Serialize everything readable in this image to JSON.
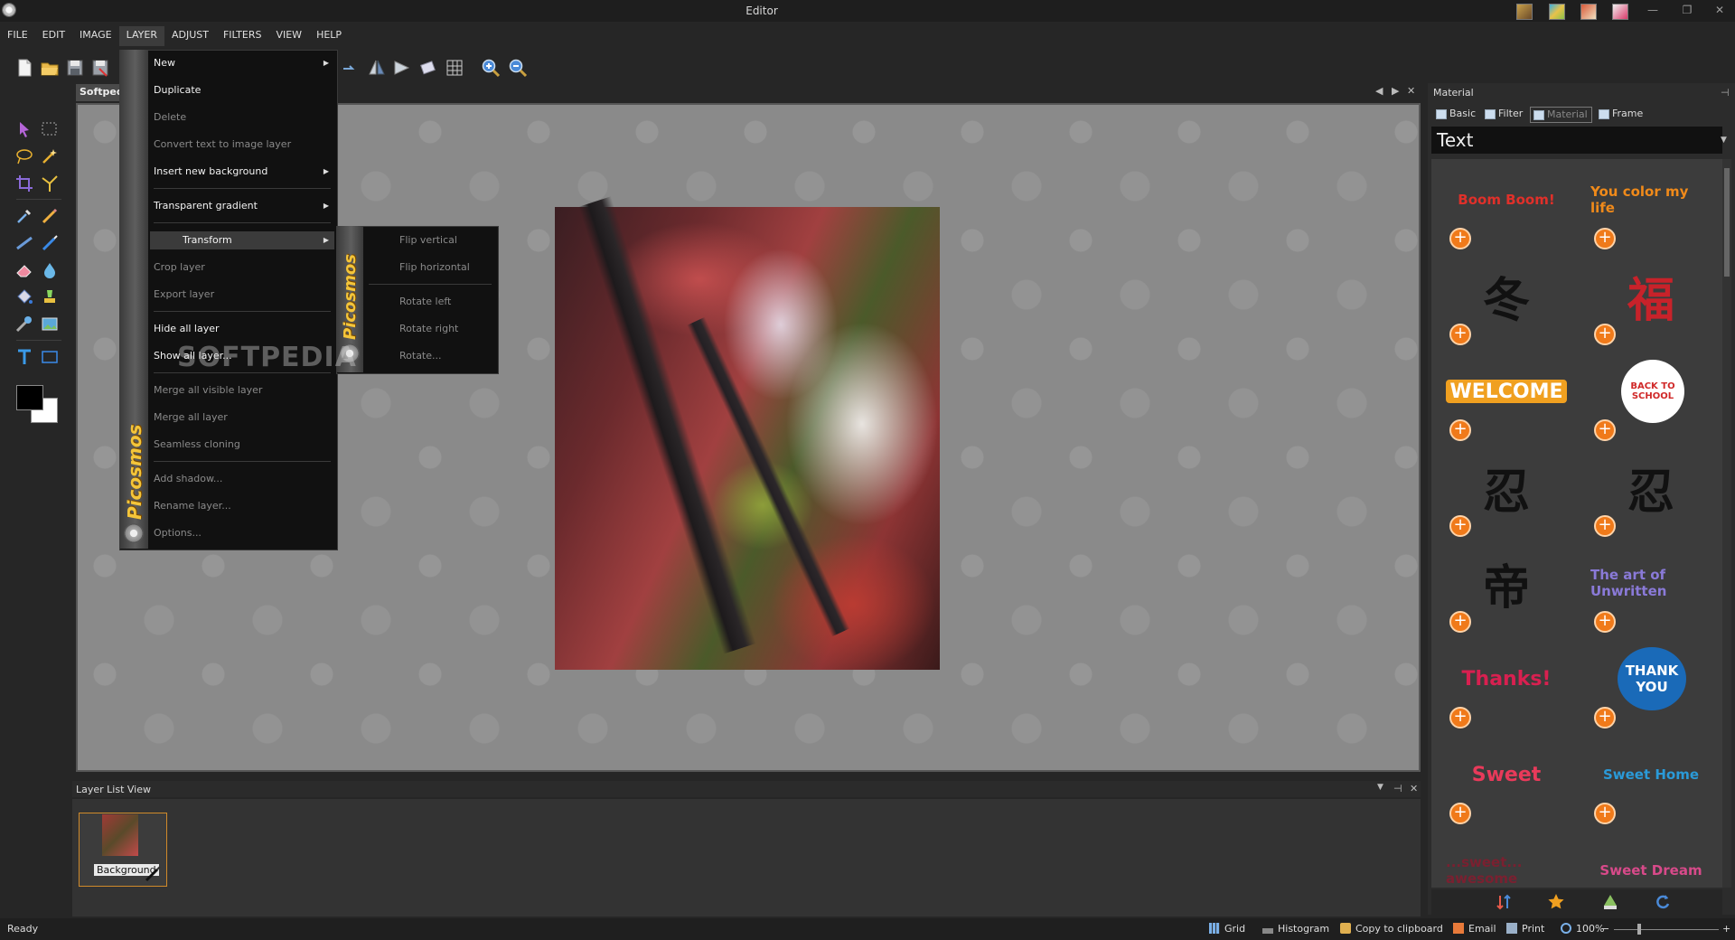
{
  "window": {
    "title": "Editor",
    "controls": {
      "minimize": "—",
      "restore": "❐",
      "close": "✕"
    }
  },
  "menubar": {
    "items": [
      {
        "label": "FILE"
      },
      {
        "label": "EDIT"
      },
      {
        "label": "IMAGE"
      },
      {
        "label": "LAYER",
        "active": true
      },
      {
        "label": "ADJUST"
      },
      {
        "label": "FILTERS"
      },
      {
        "label": "VIEW"
      },
      {
        "label": "HELP"
      }
    ]
  },
  "document": {
    "tab_label": "Softped",
    "nav": {
      "prev": "◀",
      "next": "▶",
      "close": "✕"
    }
  },
  "layer_menu": {
    "brand": "Picosmos",
    "items": [
      {
        "label": "New",
        "enabled": true,
        "submenu": true
      },
      {
        "label": "Duplicate",
        "enabled": true
      },
      {
        "label": "Delete",
        "enabled": false
      },
      {
        "label": "Convert text to image layer",
        "enabled": false
      },
      {
        "label": "Insert new background",
        "enabled": true,
        "submenu": true
      },
      {
        "label": "Transparent gradient",
        "enabled": true,
        "submenu": true
      },
      {
        "label": "Transform",
        "enabled": true,
        "submenu": true,
        "highlighted": true
      },
      {
        "label": "Crop layer",
        "enabled": false
      },
      {
        "label": "Export layer",
        "enabled": false
      },
      {
        "label": "Hide all layer",
        "enabled": true
      },
      {
        "label": "Show all layer...",
        "enabled": true
      },
      {
        "label": "Merge all visible layer",
        "enabled": false
      },
      {
        "label": "Merge all layer",
        "enabled": false
      },
      {
        "label": "Seamless cloning",
        "enabled": false
      },
      {
        "label": "Add shadow...",
        "enabled": false
      },
      {
        "label": "Rename layer...",
        "enabled": false
      },
      {
        "label": "Options...",
        "enabled": false
      }
    ]
  },
  "transform_submenu": {
    "brand": "Picosmos",
    "items": [
      {
        "label": "Flip vertical"
      },
      {
        "label": "Flip horizontal"
      },
      {
        "label": "Rotate left"
      },
      {
        "label": "Rotate right"
      },
      {
        "label": "Rotate..."
      }
    ]
  },
  "watermark": "SOFTPEDIA",
  "material_panel": {
    "title": "Material",
    "pin": "⊣",
    "tabs": [
      {
        "label": "Basic"
      },
      {
        "label": "Filter"
      },
      {
        "label": "Material",
        "active": true
      },
      {
        "label": "Frame"
      }
    ],
    "category": "Text",
    "category_arrow": "▼",
    "items": [
      {
        "art": "Boom Boom!",
        "color": "#e0302a"
      },
      {
        "art": "You color my life",
        "color": "#f08a1a"
      },
      {
        "art": "冬",
        "color": "#111111"
      },
      {
        "art": "福",
        "color": "#c8222a"
      },
      {
        "art": "WELCOME",
        "color": "#ffffff"
      },
      {
        "art": "BACK TO SCHOOL",
        "color": "#d02828"
      },
      {
        "art": "忍",
        "color": "#111111"
      },
      {
        "art": "忍",
        "color": "#111111"
      },
      {
        "art": "帝",
        "color": "#111111"
      },
      {
        "art": "The art of Unwritten",
        "color": "#8a7ad8"
      },
      {
        "art": "Thanks!",
        "color": "#d82050"
      },
      {
        "art": "THANK YOU",
        "color": "#ffffff"
      },
      {
        "art": "Sweet",
        "color": "#e83a5a"
      },
      {
        "art": "Sweet Home",
        "color": "#2a9ad8"
      },
      {
        "art": "...sweet... awesome",
        "color": "#7a2030"
      },
      {
        "art": "Sweet Dream",
        "color": "#d84a8a"
      }
    ],
    "add_symbol": "+"
  },
  "layer_list": {
    "title": "Layer List View",
    "controls": {
      "dropdown": "▼",
      "pin": "⊣",
      "close": "✕"
    },
    "layers": [
      {
        "name": "Background"
      }
    ]
  },
  "statusbar": {
    "status": "Ready",
    "items": [
      {
        "label": "Grid"
      },
      {
        "label": "Histogram"
      },
      {
        "label": "Copy to clipboard"
      },
      {
        "label": "Email"
      },
      {
        "label": "Print"
      }
    ],
    "zoom": "100%",
    "zoom_minus": "−",
    "zoom_plus": "+"
  }
}
